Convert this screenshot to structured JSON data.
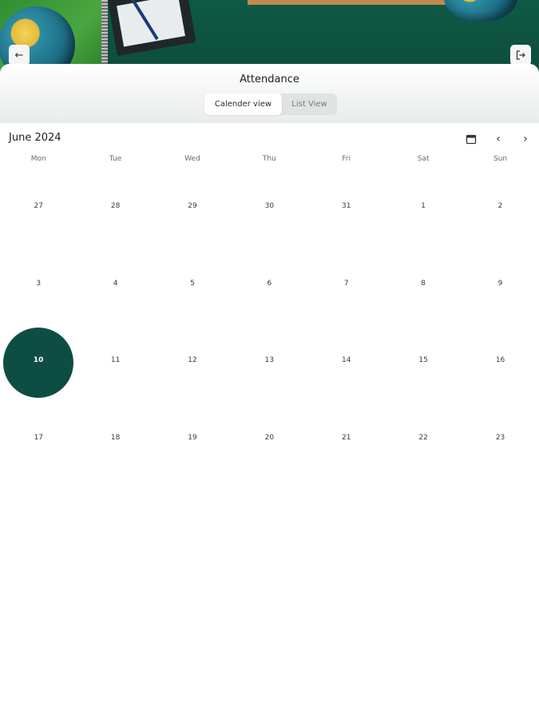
{
  "header": {
    "back_icon": "arrow-left-icon",
    "logout_icon": "logout-icon"
  },
  "page": {
    "title": "Attendance",
    "tabs": [
      {
        "label": "Calender view",
        "active": true
      },
      {
        "label": "List View",
        "active": false
      }
    ]
  },
  "calendar": {
    "month_label": "June 2024",
    "toolbar_icons": [
      "calendar-icon",
      "chevron-left-icon",
      "chevron-right-icon"
    ],
    "weekdays": [
      "Mon",
      "Tue",
      "Wed",
      "Thu",
      "Fri",
      "Sat",
      "Sun"
    ],
    "weeks": [
      [
        "27",
        "28",
        "29",
        "30",
        "31",
        "1",
        "2"
      ],
      [
        "3",
        "4",
        "5",
        "6",
        "7",
        "8",
        "9"
      ],
      [
        "10",
        "11",
        "12",
        "13",
        "14",
        "15",
        "16"
      ],
      [
        "17",
        "18",
        "19",
        "20",
        "21",
        "22",
        "23"
      ]
    ],
    "selected_day": "10",
    "selected_color": "#0e4d43"
  }
}
